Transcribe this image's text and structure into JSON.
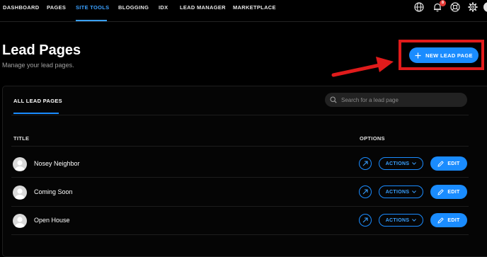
{
  "nav": {
    "items": [
      {
        "label": "DASHBOARD",
        "active": false
      },
      {
        "label": "PAGES",
        "active": false
      },
      {
        "label": "SITE TOOLS",
        "active": true
      },
      {
        "label": "BLOGGING",
        "active": false
      },
      {
        "label": "IDX",
        "active": false
      },
      {
        "label": "LEAD MANAGER",
        "active": false
      },
      {
        "label": "MARKETPLACE",
        "active": false
      }
    ],
    "icons": [
      "globe-icon",
      "bell-icon",
      "help-lifebuoy-icon",
      "gear-icon"
    ],
    "notification_count": "8"
  },
  "header": {
    "title": "Lead Pages",
    "subtitle": "Manage your lead pages.",
    "new_button_label": "NEW LEAD PAGE"
  },
  "card": {
    "tab_label": "ALL LEAD PAGES",
    "search_placeholder": "Search for a lead page",
    "columns": [
      "TITLE",
      "OPTIONS"
    ],
    "rows": [
      {
        "title": "Nosey Neighbor",
        "actions_label": "ACTIONS",
        "edit_label": "EDIT"
      },
      {
        "title": "Coming Soon",
        "actions_label": "ACTIONS",
        "edit_label": "EDIT"
      },
      {
        "title": "Open House",
        "actions_label": "ACTIONS",
        "edit_label": "EDIT"
      }
    ]
  },
  "colors": {
    "background": "#000000",
    "accent": "#1a8cff",
    "annotation_red": "#e01b1b"
  }
}
